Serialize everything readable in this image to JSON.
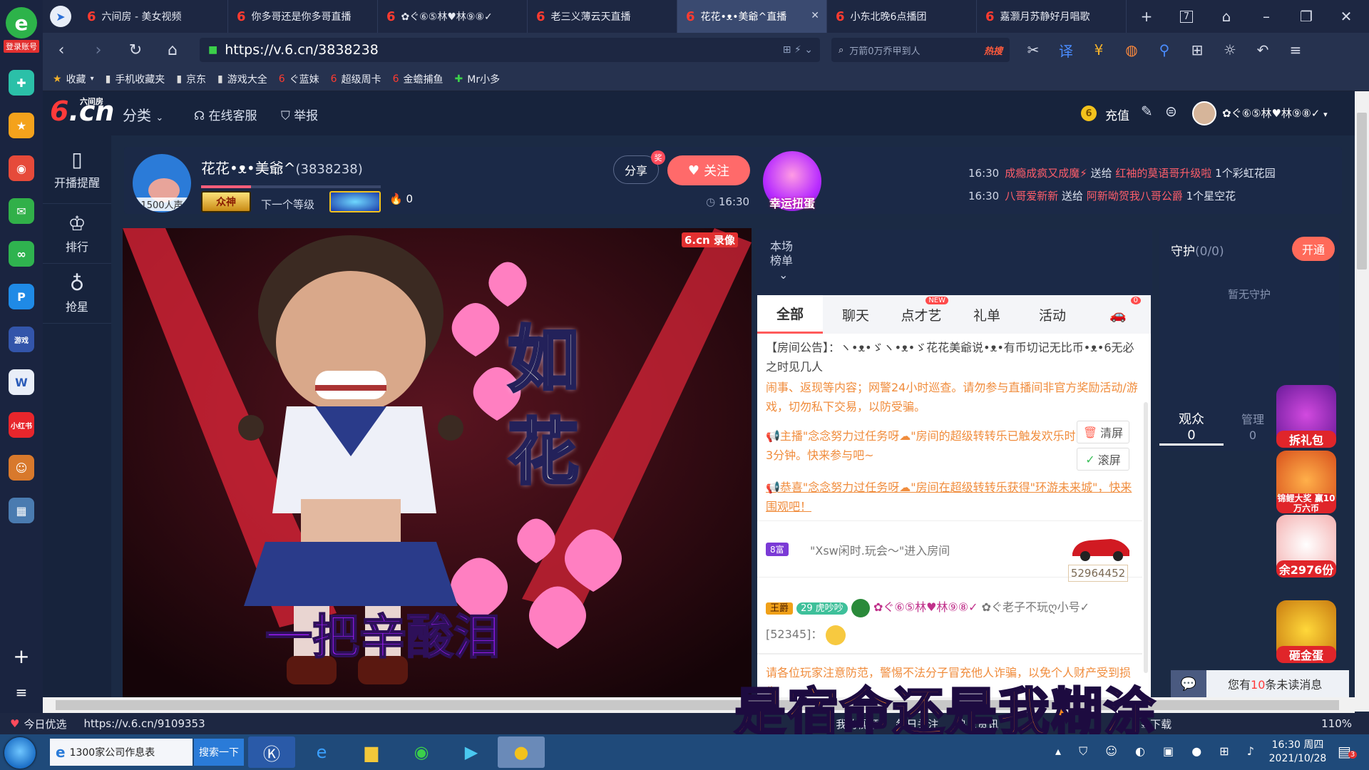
{
  "browser": {
    "tabs": [
      {
        "title": "六间房 - 美女视频"
      },
      {
        "title": "你多哥还是你多哥直播"
      },
      {
        "title": "✿ぐ⑥⑤林♥林⑨⑧✓"
      },
      {
        "title": "老三义薄云天直播"
      },
      {
        "title": "花花•ᴥ•美爺^直播",
        "active": true
      },
      {
        "title": "小东北晚6点播团"
      },
      {
        "title": "嘉灏月苏静好月唱歌"
      }
    ],
    "tab_count": "7",
    "url": "https://v.6.cn/3838238",
    "search_text": "万箭0万乔甲到人",
    "search_hot": "热搜",
    "bookmarks": [
      "收藏",
      "手机收藏夹",
      "京东",
      "游戏大全",
      "ぐ蓝妹",
      "超级周卡",
      "金蟾捕鱼",
      "Mr小多"
    ]
  },
  "sidebar": {
    "login_label": "登录账号"
  },
  "site": {
    "logo_text": "6.cn",
    "logo_sub": "六间房",
    "nav": {
      "category": "分类",
      "service": "在线客服",
      "report": "举报"
    },
    "header_right": {
      "recharge": "充值",
      "user": "✿ぐ⑥⑤林♥林⑨⑧✓"
    },
    "left_nav": [
      {
        "label": "开播提醒"
      },
      {
        "label": "排行"
      },
      {
        "label": "抢星"
      }
    ]
  },
  "anchor": {
    "name": "花花•ᴥ•美爺^",
    "room_id": "(3838238)",
    "viewers": "1500人声",
    "badge1": "众神",
    "next_level": "下一个等级",
    "heat": "0",
    "share": "分享",
    "share_tag": "奖",
    "follow": "关注",
    "time": "16:30",
    "lucky": "幸运扭蛋"
  },
  "gift_feed": [
    {
      "time": "16:30",
      "from": "成瘾成疯又成魔⚡",
      "verb": "送给",
      "to": "红袖的莫语哥升级啦",
      "item": "1个彩虹花园"
    },
    {
      "time": "16:30",
      "from": "八哥爱新新",
      "verb": "送给",
      "to": "阿新呦贺我八哥公爵",
      "item": "1个星空花"
    }
  ],
  "video": {
    "watermark": "6.cn 录像",
    "caption_big1": "如",
    "caption_big2": "花",
    "lyric_on_video": "一把辛酸泪",
    "lyric_bottom": "是宿命还是我糊涂"
  },
  "ranking": {
    "label": "本场榜单"
  },
  "chat": {
    "tabs": [
      "全部",
      "聊天",
      "点才艺",
      "礼单",
      "活动"
    ],
    "new_tag": "NEW",
    "car_badge": "0",
    "announcement": "【房间公告】：ヽ•ᴥ•ゞヽ•ᴥ•ゞ花花美爺说•ᴥ•有币切记无比币•ᴥ•6无必之时见几人",
    "warning": "闹事、返现等内容；网警24小时巡查。请勿参与直播间非官方奖励活动/游戏，切勿私下交易，以防受骗。",
    "sys1": "主播\"念念努力过任务呀☁\"房间的超级转转乐已触发欢乐时3分钟。快来参与吧~",
    "sys2": "恭喜\"念念努力过任务呀☁\"房间在超级转转乐获得\"环游未来城\"，快来围观吧！",
    "clear": "清屏",
    "scroll": "滚屏",
    "enter_tag": "8富",
    "enter_msg": "\"Xsw闲时.玩会～\"进入房间",
    "car_number": "52964452",
    "msg_tag1": "王爵",
    "msg_tag2": "29 虎吵吵",
    "msg_user": "✿ぐ⑥⑤林♥林⑨⑧✓",
    "msg_to": "✿ぐ老子不玩ღ小号✓",
    "msg_id": "[52345]：",
    "footer_warning": "请各位玩家注意防范，警惕不法分子冒充他人诈骗，以免个人财产受到损失"
  },
  "guard": {
    "title": "守护",
    "count": "(0/0)",
    "open": "开通",
    "empty": "暂无守护"
  },
  "audience": {
    "viewers_label": "观众",
    "viewers_count": "0",
    "admin_label": "管理",
    "admin_count": "0"
  },
  "promos": {
    "gift": "拆礼包",
    "koi": "锦鲤大奖 赢10万六币",
    "cat": "余2976份",
    "egg": "砸金蛋"
  },
  "unread": {
    "text_pre": "您有",
    "count": "10",
    "text_post": "条未读消息"
  },
  "statusbar": {
    "left": "今日优选",
    "url": "https://v.6.cn/9109353",
    "items": [
      "我的视频",
      "每日关注",
      "热点资讯",
      "下载"
    ],
    "zoom": "110%"
  },
  "taskbar": {
    "ie_label": "1300家公司作息表",
    "search_btn": "搜索一下",
    "time": "16:30 周四",
    "date": "2021/10/28",
    "notif": "3"
  },
  "colors": {
    "accent_red": "#ff6a6a",
    "chrome_bg": "#1d2742",
    "site_bg": "#17233c"
  }
}
